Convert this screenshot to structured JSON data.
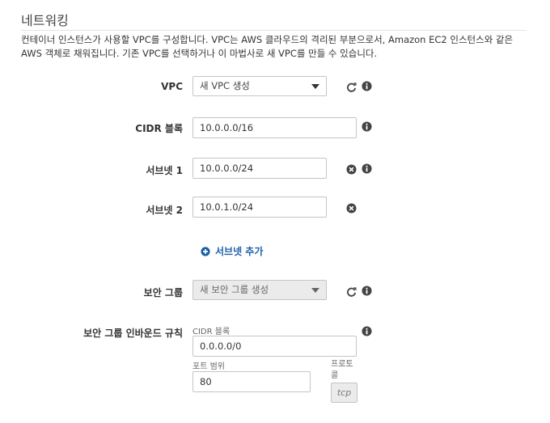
{
  "section": {
    "title": "네트워킹",
    "description": "컨테이너 인스턴스가 사용할 VPC를 구성합니다. VPC는 AWS 클라우드의 격리된 부분으로서, Amazon EC2 인스턴스와 같은 AWS 객체로 채워집니다. 기존 VPC를 선택하거나 이 마법사로 새 VPC를 만들 수 있습니다."
  },
  "vpc": {
    "label": "VPC",
    "selected": "새 VPC 생성"
  },
  "cidr": {
    "label": "CIDR 블록",
    "value": "10.0.0.0/16"
  },
  "subnet1": {
    "label": "서브넷 1",
    "value": "10.0.0.0/24"
  },
  "subnet2": {
    "label": "서브넷 2",
    "value": "10.0.1.0/24"
  },
  "add_subnet": {
    "label": "서브넷 추가"
  },
  "security_group": {
    "label": "보안 그룹",
    "selected": "새 보안 그룹 생성"
  },
  "inbound_rules": {
    "label": "보안 그룹 인바운드 규칙",
    "cidr_label": "CIDR 블록",
    "cidr_value": "0.0.0.0/0",
    "port_range_label": "포트 범위",
    "port_range_value": "80",
    "protocol_label": "프로토콜",
    "protocol_value": "tcp"
  },
  "colors": {
    "link": "#1a5fa8",
    "icon": "#444444",
    "border": "#c5c5c5"
  },
  "icons": [
    "refresh-icon",
    "info-icon",
    "remove-icon",
    "add-icon"
  ]
}
